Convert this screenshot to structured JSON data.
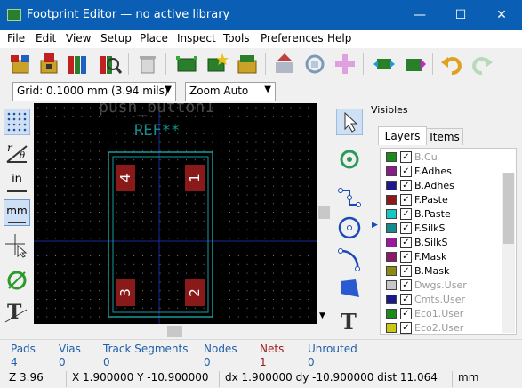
{
  "window": {
    "title": "Footprint Editor — no active library",
    "minimize": "—",
    "maximize": "☐",
    "close": "✕"
  },
  "menu": [
    "File",
    "Edit",
    "View",
    "Setup",
    "Place",
    "Inspect",
    "Tools",
    "Preferences",
    "Help"
  ],
  "toolbar": {
    "grid": "Grid: 0.1000 mm (3.94 mils)",
    "zoom": "Zoom Auto"
  },
  "lefttools": {
    "units_in": "in",
    "units_mm": "mm"
  },
  "canvas": {
    "value_text": "push_button1",
    "ref_text": "REF**",
    "pads": [
      "4",
      "1",
      "3",
      "2"
    ]
  },
  "visibles": {
    "title": "Visibles",
    "tabs": [
      "Layers",
      "Items"
    ],
    "active_tab": "Layers",
    "layers": [
      {
        "name": "B.Cu",
        "color": "#1a8a1a",
        "dim": true
      },
      {
        "name": "F.Adhes",
        "color": "#8b1a8b",
        "dim": false
      },
      {
        "name": "B.Adhes",
        "color": "#1a1a8b",
        "dim": false
      },
      {
        "name": "F.Paste",
        "color": "#8b1a1a",
        "dim": false
      },
      {
        "name": "B.Paste",
        "color": "#19c6c6",
        "dim": false
      },
      {
        "name": "F.SilkS",
        "color": "#148a8a",
        "dim": false,
        "active": true
      },
      {
        "name": "B.SilkS",
        "color": "#9b1a9b",
        "dim": false
      },
      {
        "name": "F.Mask",
        "color": "#8b1a6b",
        "dim": false
      },
      {
        "name": "B.Mask",
        "color": "#8a8a14",
        "dim": false
      },
      {
        "name": "Dwgs.User",
        "color": "#c8c8c8",
        "dim": true
      },
      {
        "name": "Cmts.User",
        "color": "#1a1a8b",
        "dim": true
      },
      {
        "name": "Eco1.User",
        "color": "#1a8a1a",
        "dim": true
      },
      {
        "name": "Eco2.User",
        "color": "#c8c819",
        "dim": true
      }
    ]
  },
  "messages": [
    {
      "label": "Pads",
      "value": "4",
      "color": "#1f5fa8"
    },
    {
      "label": "Vias",
      "value": "0",
      "color": "#1f5fa8"
    },
    {
      "label": "Track Segments",
      "value": "0",
      "color": "#1f5fa8"
    },
    {
      "label": "Nodes",
      "value": "0",
      "color": "#1f5fa8"
    },
    {
      "label": "Nets",
      "value": "1",
      "color": "#a01818"
    },
    {
      "label": "Unrouted",
      "value": "0",
      "color": "#1f5fa8"
    }
  ],
  "status": {
    "zoom": "Z 3.96",
    "xy": "X 1.900000  Y -10.900000",
    "delta": "dx 1.900000  dy -10.900000  dist 11.064",
    "units": "mm"
  }
}
